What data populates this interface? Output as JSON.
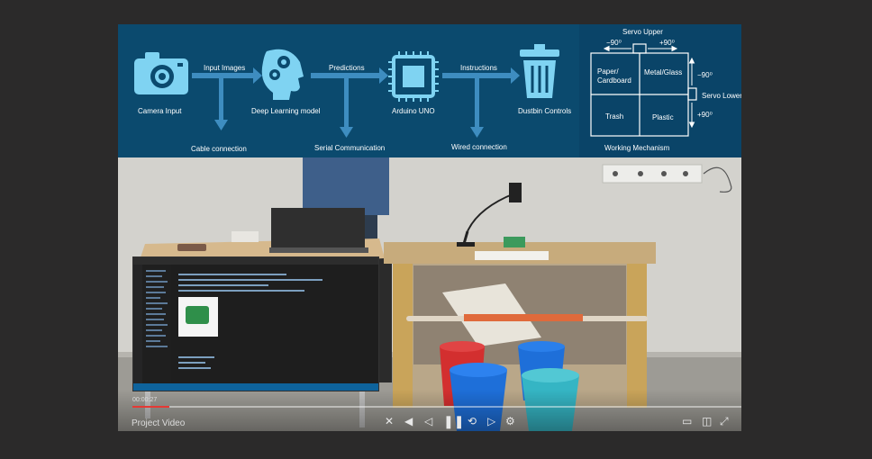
{
  "player": {
    "title": "Project Video",
    "time": "00:00:27",
    "progress": 0.06
  },
  "diagram": {
    "nodes": [
      {
        "label": "Camera Input",
        "icon": "camera-icon"
      },
      {
        "label": "Deep Learning model",
        "icon": "brain-gears-icon"
      },
      {
        "label": "Arduino UNO",
        "icon": "chip-icon"
      },
      {
        "label": "Dustbin Controls",
        "icon": "trash-bin-icon"
      }
    ],
    "edges": [
      {
        "label": "Input Images",
        "sub": "Cable connection"
      },
      {
        "label": "Predictions",
        "sub": "Serial Communication"
      },
      {
        "label": "Instructions",
        "sub": "Wired connection"
      }
    ]
  },
  "mechanism": {
    "servo_upper": "Servo Upper",
    "servo_lower": "Servo Lower",
    "upper_left_angle": "−90⁰",
    "upper_right_angle": "+90⁰",
    "lower_top_angle": "−90⁰",
    "lower_bottom_angle": "+90⁰",
    "cells": [
      "Paper/\nCardboard",
      "Metal/Glass",
      "Trash",
      "Plastic"
    ],
    "caption": "Working Mechanism"
  },
  "colors": {
    "diagram_bg": "#0b4a6e",
    "icon": "#7fd3f2",
    "bin_red": "#d32f2f",
    "bin_blue": "#1e6fd9",
    "bin_teal": "#35b5c4"
  },
  "controls": [
    "close-icon",
    "previous-icon",
    "pause-icon",
    "next-icon",
    "pip-icon",
    "speed-icon",
    "captions-icon",
    "volume-icon",
    "fullscreen-icon"
  ]
}
